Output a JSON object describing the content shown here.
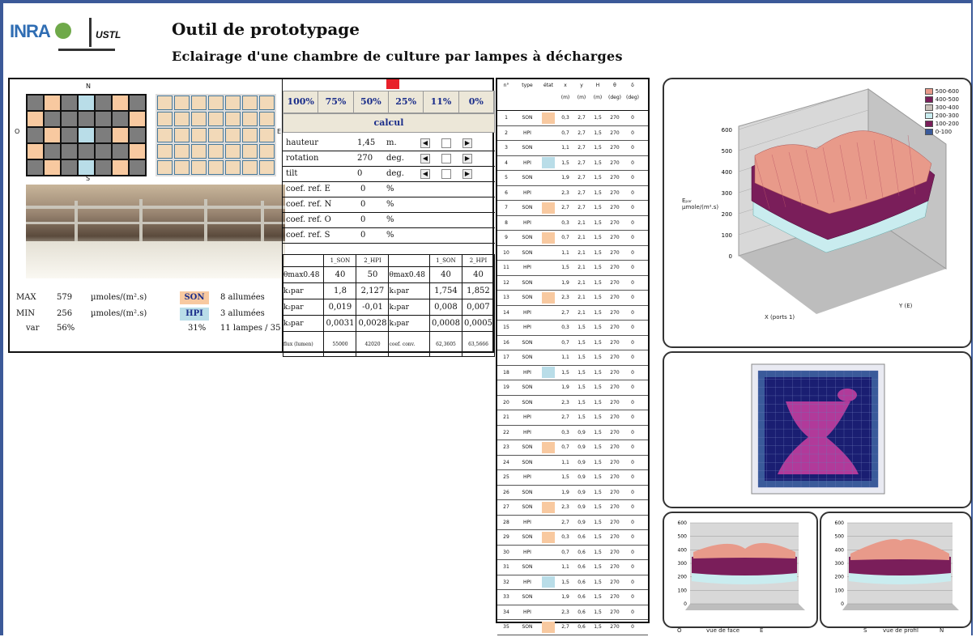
{
  "header": {
    "logo_left": "INRA",
    "logo_right": "USTL",
    "title": "Outil de prototypage",
    "subtitle": "Eclairage d'une chambre de culture par lampes à décharges"
  },
  "layout_panel": {
    "compass_n": "N",
    "compass_o": "O",
    "compass_e": "E",
    "compass_s": "S",
    "grid": [
      [
        "grey",
        "son",
        "grey",
        "hpi",
        "grey",
        "son",
        "grey"
      ],
      [
        "son",
        "grey",
        "grey",
        "grey",
        "grey",
        "grey",
        "son"
      ],
      [
        "grey",
        "son",
        "grey",
        "hpi",
        "grey",
        "son",
        "grey"
      ],
      [
        "son",
        "grey",
        "grey",
        "grey",
        "grey",
        "grey",
        "son"
      ],
      [
        "grey",
        "son",
        "grey",
        "hpi",
        "grey",
        "son",
        "grey"
      ]
    ]
  },
  "stats": {
    "max_label": "MAX",
    "max_value": "579",
    "max_unit": "µmoles/(m².s)",
    "min_label": "MIN",
    "min_value": "256",
    "min_unit": "µmoles/(m².s)",
    "var_label": "var",
    "var_value": "56%",
    "son_label": "SON",
    "son_count": "8 allumées",
    "hpi_label": "HPI",
    "hpi_count": "3 allumées",
    "total_pct": "31%",
    "total_lamps": "11 lampes / 35"
  },
  "controls": {
    "percent_buttons": [
      "100%",
      "75%",
      "50%",
      "25%",
      "11%",
      "0%"
    ],
    "calc_label": "calcul",
    "rows": [
      {
        "label": "hauteur",
        "value": "1,45",
        "unit": "m."
      },
      {
        "label": "rotation",
        "value": "270",
        "unit": "deg."
      },
      {
        "label": "tilt",
        "value": "0",
        "unit": "deg."
      }
    ],
    "coef_rows": [
      {
        "label": "coef. ref. E",
        "value": "0",
        "unit": "%"
      },
      {
        "label": "coef. ref. N",
        "value": "0",
        "unit": "%"
      },
      {
        "label": "coef. ref. O",
        "value": "0",
        "unit": "%"
      },
      {
        "label": "coef. ref. S",
        "value": "0",
        "unit": "%"
      }
    ],
    "k_table": {
      "head": [
        "",
        "1_SON",
        "2_HPI",
        "",
        "1_SON",
        "2_HPI"
      ],
      "rows": [
        [
          "θmax0.48",
          "40",
          "50",
          "θmax0.48",
          "40",
          "40"
        ],
        [
          "k₁par",
          "1,8",
          "2,127",
          "k₁par",
          "1,754",
          "1,852"
        ],
        [
          "k₂par",
          "0,019",
          "-0,01",
          "k₂par",
          "0,008",
          "0,007"
        ],
        [
          "k₃par",
          "0,0031",
          "0,0028",
          "k₃par",
          "0,0008",
          "0,0005"
        ],
        [
          "flux (lumen)",
          "55000",
          "42020",
          "coef. conv.",
          "62,3605",
          "63,5666"
        ]
      ]
    }
  },
  "lamp_table": {
    "headers": [
      "n°",
      "type",
      "état",
      "x",
      "y",
      "H",
      "θ",
      "δ"
    ],
    "units": [
      "",
      "",
      "",
      "(m)",
      "(m)",
      "(m)",
      "(deg)",
      "(deg)"
    ],
    "rows": [
      [
        "1",
        "SON",
        "son",
        "0,3",
        "2,7",
        "1,5",
        "270",
        "0"
      ],
      [
        "2",
        "HPI",
        "",
        "0,7",
        "2,7",
        "1,5",
        "270",
        "0"
      ],
      [
        "3",
        "SON",
        "",
        "1,1",
        "2,7",
        "1,5",
        "270",
        "0"
      ],
      [
        "4",
        "HPI",
        "hpi",
        "1,5",
        "2,7",
        "1,5",
        "270",
        "0"
      ],
      [
        "5",
        "SON",
        "",
        "1,9",
        "2,7",
        "1,5",
        "270",
        "0"
      ],
      [
        "6",
        "HPI",
        "",
        "2,3",
        "2,7",
        "1,5",
        "270",
        "0"
      ],
      [
        "7",
        "SON",
        "son",
        "2,7",
        "2,7",
        "1,5",
        "270",
        "0"
      ],
      [
        "8",
        "HPI",
        "",
        "0,3",
        "2,1",
        "1,5",
        "270",
        "0"
      ],
      [
        "9",
        "SON",
        "son",
        "0,7",
        "2,1",
        "1,5",
        "270",
        "0"
      ],
      [
        "10",
        "SON",
        "",
        "1,1",
        "2,1",
        "1,5",
        "270",
        "0"
      ],
      [
        "11",
        "HPI",
        "",
        "1,5",
        "2,1",
        "1,5",
        "270",
        "0"
      ],
      [
        "12",
        "SON",
        "",
        "1,9",
        "2,1",
        "1,5",
        "270",
        "0"
      ],
      [
        "13",
        "SON",
        "son",
        "2,3",
        "2,1",
        "1,5",
        "270",
        "0"
      ],
      [
        "14",
        "HPI",
        "",
        "2,7",
        "2,1",
        "1,5",
        "270",
        "0"
      ],
      [
        "15",
        "HPI",
        "",
        "0,3",
        "1,5",
        "1,5",
        "270",
        "0"
      ],
      [
        "16",
        "SON",
        "",
        "0,7",
        "1,5",
        "1,5",
        "270",
        "0"
      ],
      [
        "17",
        "SON",
        "",
        "1,1",
        "1,5",
        "1,5",
        "270",
        "0"
      ],
      [
        "18",
        "HPI",
        "hpi",
        "1,5",
        "1,5",
        "1,5",
        "270",
        "0"
      ],
      [
        "19",
        "SON",
        "",
        "1,9",
        "1,5",
        "1,5",
        "270",
        "0"
      ],
      [
        "20",
        "SON",
        "",
        "2,3",
        "1,5",
        "1,5",
        "270",
        "0"
      ],
      [
        "21",
        "HPI",
        "",
        "2,7",
        "1,5",
        "1,5",
        "270",
        "0"
      ],
      [
        "22",
        "HPI",
        "",
        "0,3",
        "0,9",
        "1,5",
        "270",
        "0"
      ],
      [
        "23",
        "SON",
        "son",
        "0,7",
        "0,9",
        "1,5",
        "270",
        "0"
      ],
      [
        "24",
        "SON",
        "",
        "1,1",
        "0,9",
        "1,5",
        "270",
        "0"
      ],
      [
        "25",
        "HPI",
        "",
        "1,5",
        "0,9",
        "1,5",
        "270",
        "0"
      ],
      [
        "26",
        "SON",
        "",
        "1,9",
        "0,9",
        "1,5",
        "270",
        "0"
      ],
      [
        "27",
        "SON",
        "son",
        "2,3",
        "0,9",
        "1,5",
        "270",
        "0"
      ],
      [
        "28",
        "HPI",
        "",
        "2,7",
        "0,9",
        "1,5",
        "270",
        "0"
      ],
      [
        "29",
        "SON",
        "son",
        "0,3",
        "0,6",
        "1,5",
        "270",
        "0"
      ],
      [
        "30",
        "HPI",
        "",
        "0,7",
        "0,6",
        "1,5",
        "270",
        "0"
      ],
      [
        "31",
        "SON",
        "",
        "1,1",
        "0,6",
        "1,5",
        "270",
        "0"
      ],
      [
        "32",
        "HPI",
        "hpi",
        "1,5",
        "0,6",
        "1,5",
        "270",
        "0"
      ],
      [
        "33",
        "SON",
        "",
        "1,9",
        "0,6",
        "1,5",
        "270",
        "0"
      ],
      [
        "34",
        "HPI",
        "",
        "2,3",
        "0,6",
        "1,5",
        "270",
        "0"
      ],
      [
        "35",
        "SON",
        "son",
        "2,7",
        "0,6",
        "1,5",
        "270",
        "0"
      ]
    ]
  },
  "colors": {
    "son": "#f8c9a0",
    "hpi": "#b9dde8",
    "grey": "#7d7d7d",
    "accent_text": "#1a2d8a",
    "frame": "#3b5998",
    "selected_marker": "#e8212a"
  },
  "chart_data": [
    {
      "type": "surface",
      "zlabel": "Eₚₐᵣ µmole/(m².s)",
      "xlabel": "X (ports 1)",
      "ylabel": "Y (E)",
      "zlim": [
        0,
        600
      ],
      "zticks": [
        "0",
        "100",
        "200",
        "300",
        "400",
        "500",
        "600"
      ],
      "legend": [
        "500-600",
        "400-500",
        "300-400",
        "200-300",
        "100-200",
        "0-100"
      ],
      "legend_colors": [
        "#e89a8a",
        "#7a1e5a",
        "#c8c0b8",
        "#c9ecef",
        "#7a1e5a",
        "#3a5a9a"
      ],
      "legend_placement": "top-right"
    },
    {
      "type": "heatmap",
      "title": ""
    },
    {
      "type": "area",
      "xlabel_left": "O",
      "xlabel_mid": "vue de face",
      "xlabel_right": "E",
      "yticks": [
        "0",
        "100",
        "200",
        "300",
        "400",
        "500",
        "600"
      ],
      "ylim": [
        0,
        600
      ]
    },
    {
      "type": "area",
      "xlabel_left": "S",
      "xlabel_mid": "vue de profil",
      "xlabel_right": "N",
      "yticks": [
        "0",
        "100",
        "200",
        "300",
        "400",
        "500",
        "600"
      ],
      "ylim": [
        0,
        600
      ]
    }
  ]
}
